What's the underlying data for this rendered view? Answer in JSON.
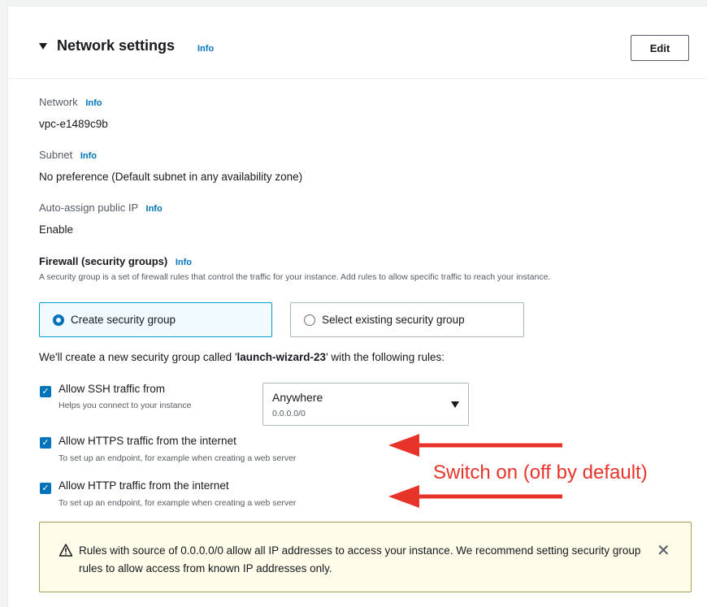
{
  "header": {
    "title": "Network settings",
    "info": "Info",
    "edit_label": "Edit"
  },
  "network": {
    "label": "Network",
    "info": "Info",
    "value": "vpc-e1489c9b"
  },
  "subnet": {
    "label": "Subnet",
    "info": "Info",
    "value": "No preference (Default subnet in any availability zone)"
  },
  "auto_ip": {
    "label": "Auto-assign public IP",
    "info": "Info",
    "value": "Enable"
  },
  "firewall": {
    "title": "Firewall (security groups)",
    "info": "Info",
    "description": "A security group is a set of firewall rules that control the traffic for your instance. Add rules to allow specific traffic to reach your instance.",
    "options": [
      {
        "label": "Create security group",
        "selected": true
      },
      {
        "label": "Select existing security group",
        "selected": false
      }
    ],
    "create_prefix": "We'll create a new security group called '",
    "group_name": "launch-wizard-23",
    "create_suffix": "' with the following rules:"
  },
  "rules": [
    {
      "label": "Allow SSH traffic from",
      "sub": "Helps you connect to your instance",
      "checked": true
    },
    {
      "label": "Allow HTTPS traffic from the internet",
      "sub": "To set up an endpoint, for example when creating a web server",
      "checked": true
    },
    {
      "label": "Allow HTTP traffic from the internet",
      "sub": "To set up an endpoint, for example when creating a web server",
      "checked": true
    }
  ],
  "ssh_source": {
    "value": "Anywhere",
    "sub": "0.0.0.0/0"
  },
  "alert": {
    "text": "Rules with source of 0.0.0.0/0 allow all IP addresses to access your instance. We recommend setting security group rules to allow access from known IP addresses only.",
    "icon": "warning-icon",
    "close": "✕"
  },
  "annotation": {
    "text": "Switch on (off by default)",
    "color": "#e8332b"
  },
  "colors": {
    "accent": "#0073bb",
    "annotation": "#e8332b"
  }
}
